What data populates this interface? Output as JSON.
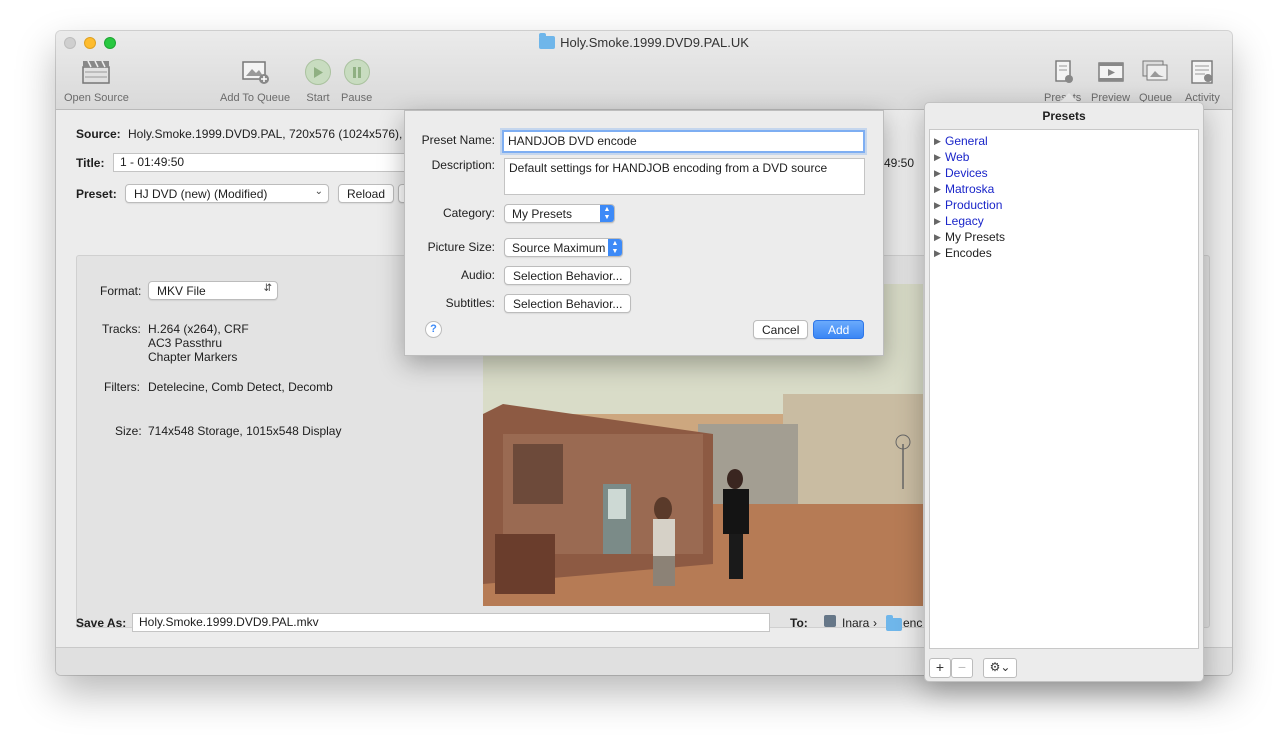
{
  "window": {
    "title": "Holy.Smoke.1999.DVD9.PAL.UK"
  },
  "toolbar": {
    "open_source": "Open Source",
    "add_to_queue": "Add To Queue",
    "start": "Start",
    "pause": "Pause",
    "presets": "Presets",
    "preview": "Preview",
    "queue": "Queue",
    "activity": "Activity"
  },
  "main": {
    "source_label": "Source:",
    "source_value": "Holy.Smoke.1999.DVD9.PAL, 720x576 (1024x576), 2",
    "title_label": "Title:",
    "title_value": "1 - 01:49:50",
    "duration_tail": "49:50",
    "preset_label": "Preset:",
    "preset_value": "HJ DVD (new) (Modified)",
    "reload": "Reload",
    "format_label": "Format:",
    "format_value": "MKV File",
    "tracks_label": "Tracks:",
    "tracks": [
      "H.264 (x264), CRF",
      "AC3 Passthru",
      "Chapter Markers"
    ],
    "filters_label": "Filters:",
    "filters_value": "Detelecine, Comb Detect, Decomb",
    "size_label": "Size:",
    "size_value": "714x548 Storage, 1015x548 Display",
    "save_as_label": "Save As:",
    "save_as_value": "Holy.Smoke.1999.DVD9.PAL.mkv",
    "to_label": "To:",
    "to_user": "Inara",
    "to_sep": "›",
    "to_folder": "enc"
  },
  "dialog": {
    "preset_name_label": "Preset Name:",
    "preset_name_value": "HANDJOB DVD encode",
    "description_label": "Description:",
    "description_value": "Default settings for HANDJOB encoding from a DVD source",
    "category_label": "Category:",
    "category_value": "My Presets",
    "picture_size_label": "Picture Size:",
    "picture_size_value": "Source Maximum",
    "audio_label": "Audio:",
    "audio_value": "Selection Behavior...",
    "subtitles_label": "Subtitles:",
    "subtitles_value": "Selection Behavior...",
    "help": "?",
    "cancel": "Cancel",
    "add": "Add"
  },
  "presets_panel": {
    "title": "Presets",
    "items": [
      {
        "label": "General"
      },
      {
        "label": "Web"
      },
      {
        "label": "Devices"
      },
      {
        "label": "Matroska"
      },
      {
        "label": "Production"
      },
      {
        "label": "Legacy"
      },
      {
        "label": "My Presets"
      },
      {
        "label": "Encodes"
      }
    ],
    "add_button": "+",
    "remove_button": "−"
  },
  "colors": {
    "accent": "#3d8af7",
    "preset_link": "#1a25c9",
    "window_bg": "#ececec"
  }
}
